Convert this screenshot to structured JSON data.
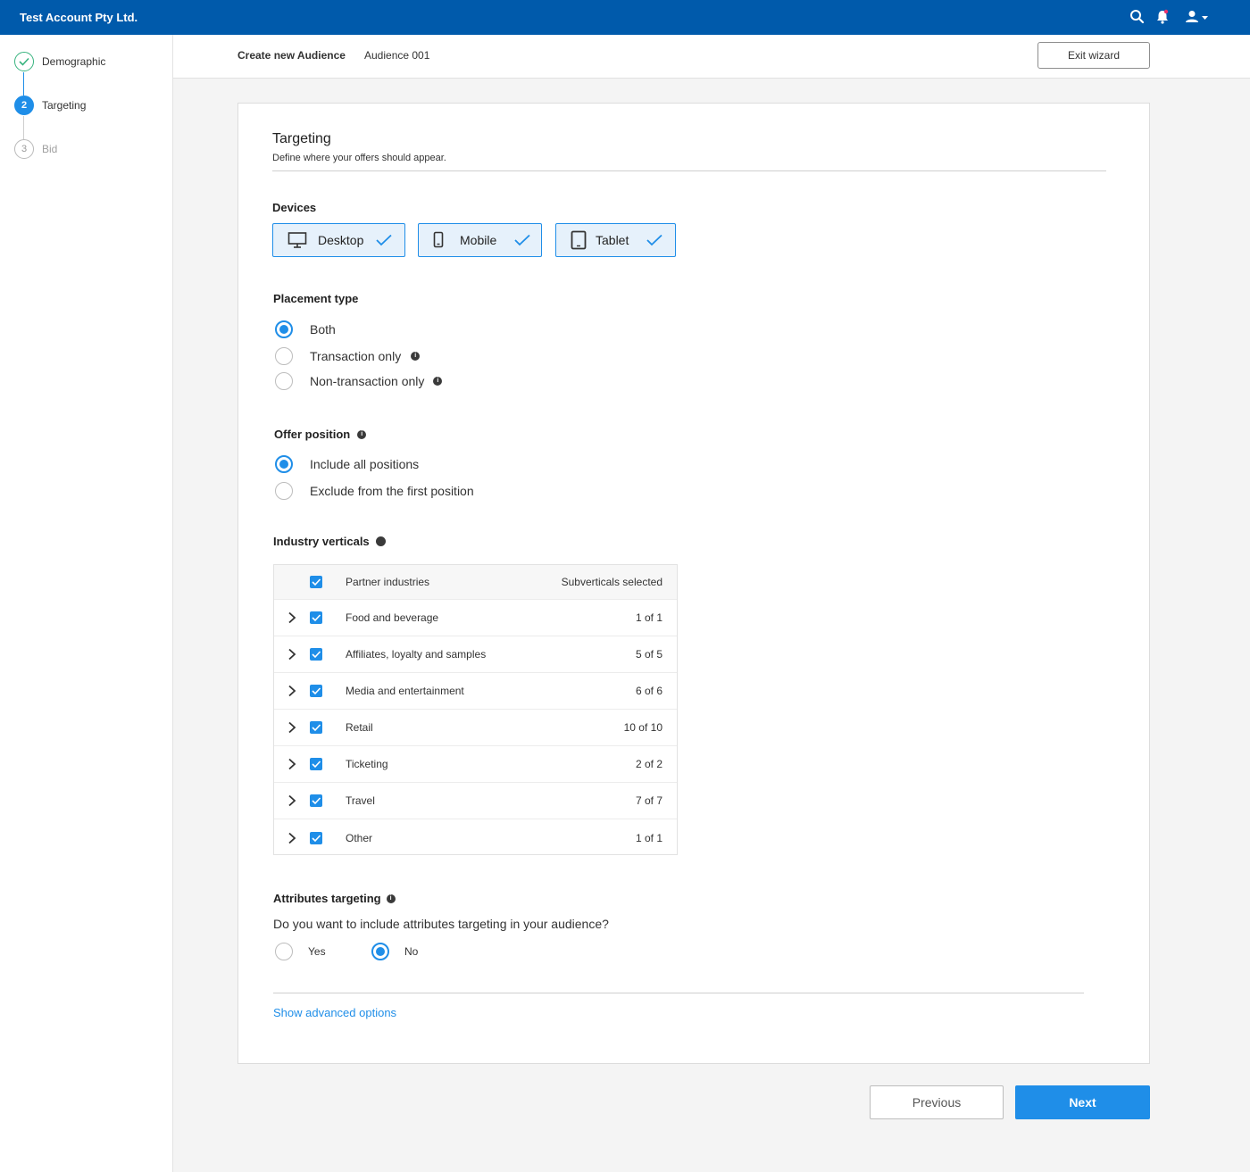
{
  "topbar": {
    "account_name": "Test Account Pty Ltd.",
    "icons": [
      "search-icon",
      "bell-icon",
      "user-icon",
      "caret-down-icon"
    ]
  },
  "sidebar": {
    "steps": [
      {
        "label": "Demographic",
        "state": "done"
      },
      {
        "number": "2",
        "label": "Targeting",
        "state": "active"
      },
      {
        "number": "3",
        "label": "Bid",
        "state": "todo"
      }
    ]
  },
  "header": {
    "title": "Create new Audience",
    "audience_name": "Audience 001",
    "exit_label": "Exit wizard"
  },
  "targeting": {
    "title": "Targeting",
    "subtitle": "Define where your offers should appear."
  },
  "devices": {
    "label": "Devices",
    "items": [
      {
        "label": "Desktop",
        "icon": "desktop-icon",
        "selected": true
      },
      {
        "label": "Mobile",
        "icon": "mobile-icon",
        "selected": true
      },
      {
        "label": "Tablet",
        "icon": "tablet-icon",
        "selected": true
      }
    ]
  },
  "placement": {
    "label": "Placement type",
    "options": [
      {
        "label": "Both",
        "selected": true
      },
      {
        "label": "Transaction only",
        "selected": false
      },
      {
        "label": "Non-transaction only",
        "selected": false
      }
    ]
  },
  "offer_position": {
    "label": "Offer position",
    "options": [
      {
        "label": "Include all positions",
        "selected": true
      },
      {
        "label": "Exclude from the first position",
        "selected": false
      }
    ]
  },
  "industry": {
    "label": "Industry verticals",
    "header_name": "Partner industries",
    "header_count": "Subverticals selected",
    "rows": [
      {
        "name": "Food and beverage",
        "count": "1 of 1"
      },
      {
        "name": "Affiliates, loyalty and samples",
        "count": "5 of 5"
      },
      {
        "name": "Media and entertainment",
        "count": "6 of 6"
      },
      {
        "name": "Retail",
        "count": "10 of 10"
      },
      {
        "name": "Ticketing",
        "count": "2 of 2"
      },
      {
        "name": "Travel",
        "count": "7 of 7"
      },
      {
        "name": "Other",
        "count": "1 of 1"
      }
    ]
  },
  "attributes": {
    "label": "Attributes targeting",
    "question": "Do you want to include attributes targeting in your audience?",
    "options": [
      {
        "label": "Yes",
        "selected": false
      },
      {
        "label": "No",
        "selected": true
      }
    ]
  },
  "advanced_label": "Show advanced options",
  "footer": {
    "previous_label": "Previous",
    "next_label": "Next"
  },
  "colors": {
    "brand": "#005aab",
    "accent": "#1f8ee8",
    "success": "#37b37e",
    "notification": "#e8336e"
  }
}
